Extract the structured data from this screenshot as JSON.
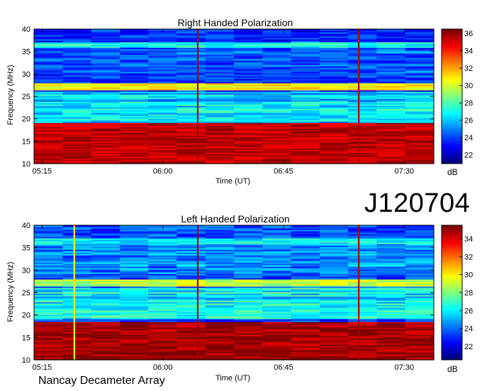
{
  "panels": [
    {
      "title": "Right Handed Polarization",
      "ylabel": "Frequency (MHz)",
      "xlabel": "Time (UT)",
      "colorbar_label": "dB"
    },
    {
      "title": "Left Handed Polarization",
      "ylabel": "Frequency (MHz)",
      "xlabel": "Time (UT)",
      "colorbar_label": "dB"
    }
  ],
  "observation_id": "J120704",
  "instrument": "Nancay Decameter Array",
  "colormap": [
    "#00007f",
    "#0000ff",
    "#007fff",
    "#00ffff",
    "#7fff7f",
    "#ffff00",
    "#ff7f00",
    "#ff0000",
    "#7f0000"
  ],
  "chart_data": [
    {
      "type": "heatmap",
      "title": "Right Handed Polarization",
      "xlabel": "Time (UT)",
      "ylabel": "Frequency (MHz)",
      "x_ticks": [
        "05:15",
        "06:00",
        "06:45",
        "07:30"
      ],
      "x_tick_minutes": [
        315,
        360,
        405,
        450
      ],
      "xlim_minutes": [
        312,
        461
      ],
      "y_ticks": [
        10,
        15,
        20,
        25,
        30,
        35,
        40
      ],
      "ylim": [
        10,
        40
      ],
      "colorbar": {
        "label": "dB",
        "ticks": [
          22,
          24,
          26,
          28,
          30,
          32,
          34,
          36
        ],
        "range": [
          21,
          36.5
        ]
      },
      "features": [
        {
          "kind": "band",
          "freq_range": [
            10,
            19
          ],
          "level_db": 35.5
        },
        {
          "kind": "band",
          "freq_range": [
            26.5,
            28
          ],
          "level_db": 31
        },
        {
          "kind": "band",
          "freq_range": [
            21.5,
            22.3
          ],
          "level_db": 27
        },
        {
          "kind": "band",
          "freq_range": [
            36,
            37
          ],
          "level_db": 27
        },
        {
          "kind": "vertical_line",
          "time_minutes": 373,
          "level_db": 36
        },
        {
          "kind": "vertical_line",
          "time_minutes": 433,
          "level_db": 36
        }
      ]
    },
    {
      "type": "heatmap",
      "title": "Left Handed Polarization",
      "xlabel": "Time (UT)",
      "ylabel": "Frequency (MHz)",
      "x_ticks": [
        "05:15",
        "06:00",
        "06:45",
        "07:30"
      ],
      "x_tick_minutes": [
        315,
        360,
        405,
        450
      ],
      "xlim_minutes": [
        312,
        461
      ],
      "y_ticks": [
        10,
        15,
        20,
        25,
        30,
        35,
        40
      ],
      "ylim": [
        10,
        40
      ],
      "colorbar": {
        "label": "dB",
        "ticks": [
          22,
          24,
          26,
          28,
          30,
          32,
          34
        ],
        "range": [
          20.5,
          35.5
        ]
      },
      "features": [
        {
          "kind": "band",
          "freq_range": [
            10,
            18.5
          ],
          "level_db": 35
        },
        {
          "kind": "band",
          "freq_range": [
            26.5,
            28
          ],
          "level_db": 29
        },
        {
          "kind": "band",
          "freq_range": [
            36,
            37
          ],
          "level_db": 26
        },
        {
          "kind": "vertical_line",
          "time_minutes": 373,
          "level_db": 35
        },
        {
          "kind": "vertical_line",
          "time_minutes": 433,
          "level_db": 35
        },
        {
          "kind": "vertical_line",
          "time_minutes": 327,
          "level_db": 30
        }
      ]
    }
  ]
}
